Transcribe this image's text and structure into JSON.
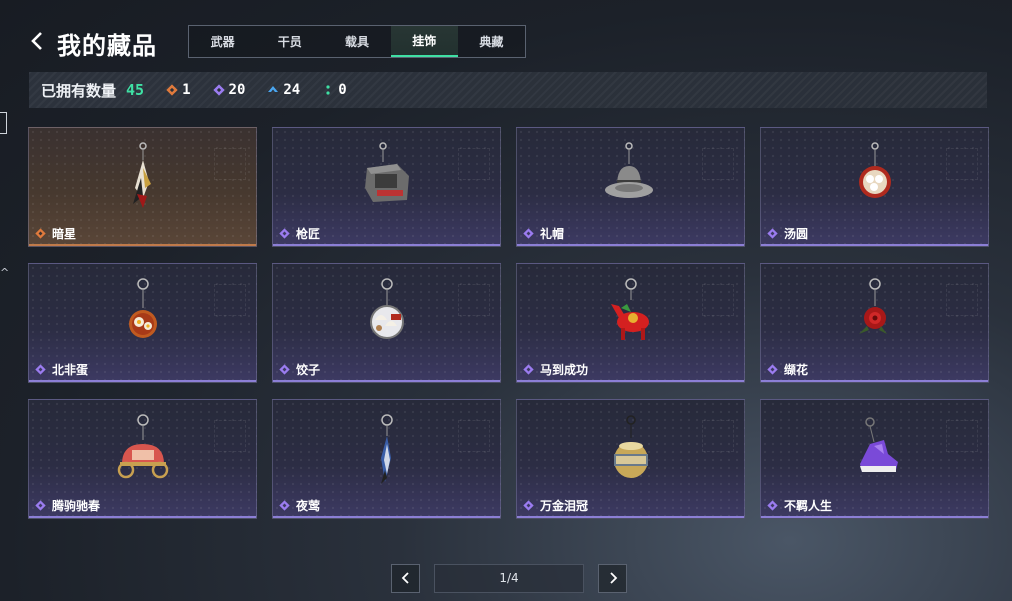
{
  "header": {
    "title": "我的藏品"
  },
  "tabs": [
    {
      "label": "武器",
      "active": false
    },
    {
      "label": "干员",
      "active": false
    },
    {
      "label": "载具",
      "active": false
    },
    {
      "label": "挂饰",
      "active": true
    },
    {
      "label": "典藏",
      "active": false
    }
  ],
  "summary": {
    "label": "已拥有数量",
    "total": "45",
    "counts": [
      {
        "rarity": "orange",
        "value": "1",
        "color": "#e07a3c"
      },
      {
        "rarity": "purple",
        "value": "20",
        "color": "#9b7cf0"
      },
      {
        "rarity": "blue",
        "value": "24",
        "color": "#4aa6f0"
      },
      {
        "rarity": "green",
        "value": "0",
        "color": "#3fe0a4"
      }
    ]
  },
  "items": [
    {
      "name": "暗星",
      "rarity": "orange",
      "icon": "dark-star-charm-icon"
    },
    {
      "name": "枪匠",
      "rarity": "purple",
      "icon": "gunsmith-charm-icon"
    },
    {
      "name": "礼帽",
      "rarity": "purple",
      "icon": "top-hat-charm-icon"
    },
    {
      "name": "汤圆",
      "rarity": "purple",
      "icon": "tangyuan-charm-icon"
    },
    {
      "name": "北非蛋",
      "rarity": "purple",
      "icon": "shakshuka-charm-icon"
    },
    {
      "name": "饺子",
      "rarity": "purple",
      "icon": "dumpling-charm-icon"
    },
    {
      "name": "马到成功",
      "rarity": "purple",
      "icon": "horse-charm-icon"
    },
    {
      "name": "缬花",
      "rarity": "purple",
      "icon": "flower-charm-icon"
    },
    {
      "name": "腾驹驰春",
      "rarity": "purple",
      "icon": "carriage-charm-icon"
    },
    {
      "name": "夜莺",
      "rarity": "purple",
      "icon": "nightingale-charm-icon"
    },
    {
      "name": "万金泪冠",
      "rarity": "purple",
      "icon": "crown-charm-icon"
    },
    {
      "name": "不羁人生",
      "rarity": "purple",
      "icon": "sneaker-charm-icon"
    }
  ],
  "pagination": {
    "current": "1/4"
  }
}
